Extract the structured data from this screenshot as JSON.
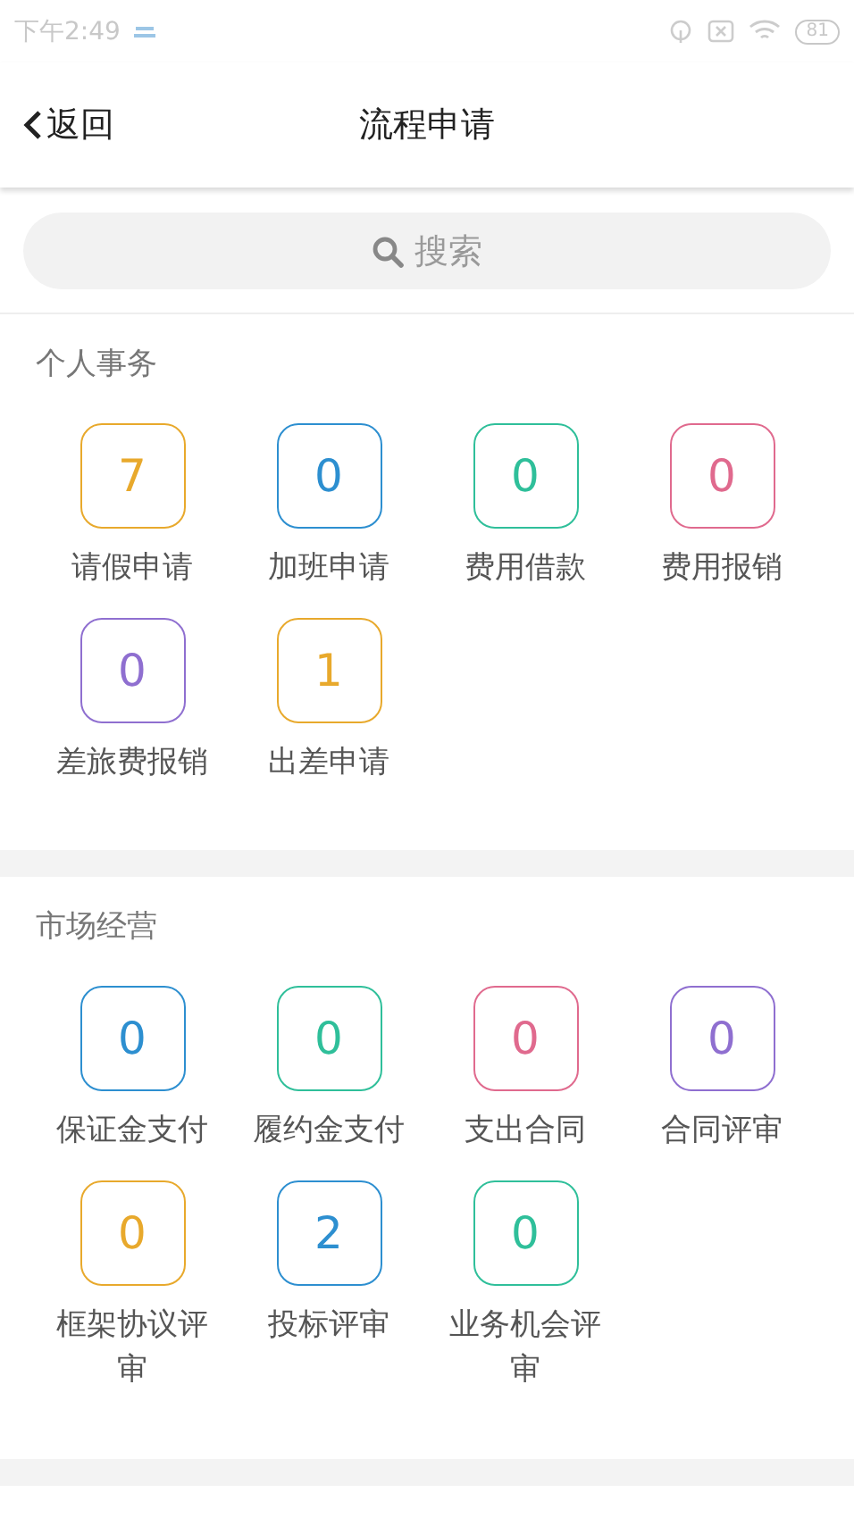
{
  "status_bar": {
    "time": "下午2:49",
    "battery": "81"
  },
  "header": {
    "back": "返回",
    "title": "流程申请"
  },
  "search": {
    "placeholder": "搜索"
  },
  "sections": [
    {
      "title": "个人事务",
      "items": [
        {
          "count": "7",
          "label": "请假申请",
          "color": "#e8a92c"
        },
        {
          "count": "0",
          "label": "加班申请",
          "color": "#2d8fd0"
        },
        {
          "count": "0",
          "label": "费用借款",
          "color": "#2fbf9a"
        },
        {
          "count": "0",
          "label": "费用报销",
          "color": "#e06a8e"
        },
        {
          "count": "0",
          "label": "差旅费报销",
          "color": "#8f6fd0"
        },
        {
          "count": "1",
          "label": "出差申请",
          "color": "#e8a92c"
        }
      ]
    },
    {
      "title": "市场经营",
      "items": [
        {
          "count": "0",
          "label": "保证金支付",
          "color": "#2d8fd0"
        },
        {
          "count": "0",
          "label": "履约金支付",
          "color": "#2fbf9a"
        },
        {
          "count": "0",
          "label": "支出合同",
          "color": "#e06a8e"
        },
        {
          "count": "0",
          "label": "合同评审",
          "color": "#8f6fd0"
        },
        {
          "count": "0",
          "label": "框架协议评审",
          "color": "#e8a92c"
        },
        {
          "count": "2",
          "label": "投标评审",
          "color": "#2d8fd0"
        },
        {
          "count": "0",
          "label": "业务机会评审",
          "color": "#2fbf9a"
        }
      ]
    }
  ]
}
